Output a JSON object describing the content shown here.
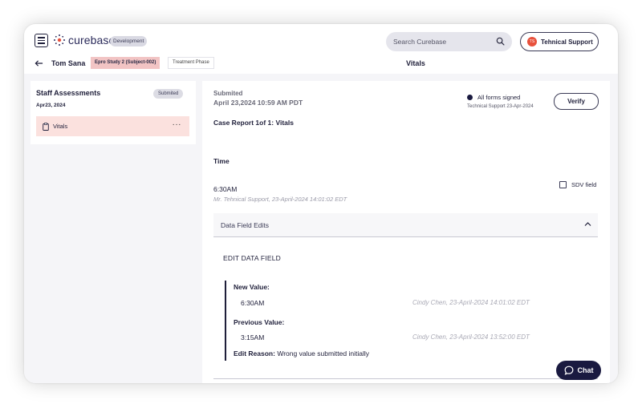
{
  "app": {
    "logo_text": "curebase",
    "environment": "Development",
    "brand_color": "#2a2a5a",
    "accent_color": "#e8513c"
  },
  "header": {
    "search": {
      "placeholder": "Search Curebase",
      "icon": "search-icon"
    },
    "support": {
      "avatar_initials": "TS",
      "label": "Tehnical Support"
    },
    "menu_icon": "hamburger-icon"
  },
  "subheader": {
    "back_icon": "arrow-left-icon",
    "patient_name": "Tom Sana",
    "study": "Epro Study 2 (Subject-002)",
    "phase": "Treatment Phase",
    "page_title": "Vitals"
  },
  "sidebar": {
    "section_title": "Staff Assessments",
    "section_date": "Apr23, 2024",
    "section_status": "Submited",
    "items": [
      {
        "label": "Vitals",
        "icon": "clipboard-icon",
        "more": "···"
      }
    ]
  },
  "main": {
    "submitted_label": "Submited",
    "submitted_date": "April 23,2024 10:59 AM PDT",
    "signed_text": "All forms signed",
    "signed_meta": "Technical Support 23-Apr-2024",
    "verify_label": "Verify",
    "case_report": "Case Report 1of 1: Vitals",
    "field": {
      "label": "Time",
      "value": "6:30AM",
      "audit": "Mr. Tehnical Support, 23-April-2024 14:01:02 EDT",
      "sdv_label": "SDV field"
    },
    "edits": {
      "title": "Data Field Edits",
      "section_title": "EDIT DATA FIELD",
      "new_value_label": "New Value:",
      "new_value": "6:30AM",
      "new_value_audit": "Cindy Chen, 23-April-2024 14:01:02 EDT",
      "previous_value_label": "Previous Value:",
      "previous_value": "3:15AM",
      "previous_value_audit": "Cindy Chen, 23-April-2024 13:52:00 EDT",
      "reason_label": "Edit Reason:",
      "reason": "Wrong value submitted initially"
    }
  },
  "chat": {
    "label": "Chat",
    "icon": "chat-bubble-icon"
  }
}
